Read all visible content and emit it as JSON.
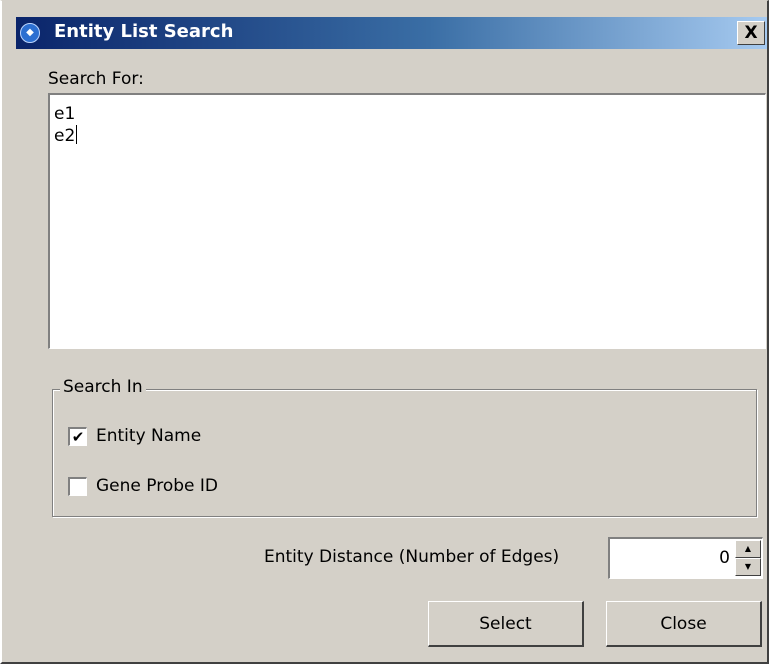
{
  "window": {
    "title": "Entity List Search",
    "close_label": "X"
  },
  "search_for": {
    "label": "Search For:",
    "lines": [
      "e1",
      "e2"
    ]
  },
  "search_in": {
    "title": "Search In",
    "options": [
      {
        "label": "Entity Name",
        "checked": true
      },
      {
        "label": "Gene Probe ID",
        "checked": false
      }
    ]
  },
  "distance": {
    "label": "Entity Distance (Number of Edges)",
    "value": "0"
  },
  "buttons": {
    "select": "Select",
    "close": "Close"
  },
  "icons": {
    "app": "app-icon",
    "check": "✔",
    "spin_up": "▲",
    "spin_down": "▼"
  }
}
